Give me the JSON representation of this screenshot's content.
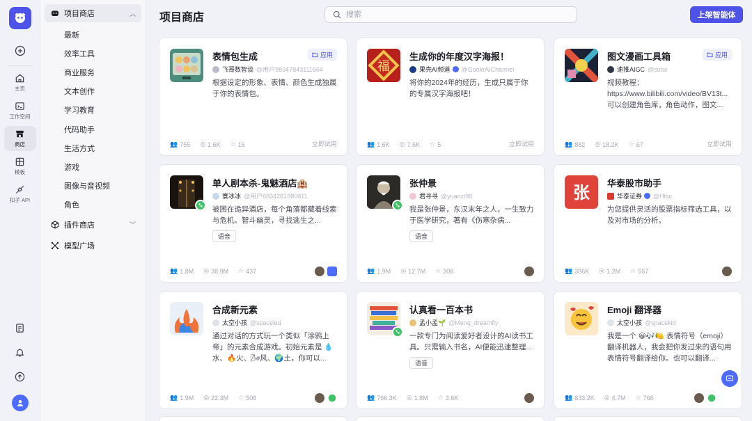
{
  "rail": {
    "items": [
      {
        "label": "主页",
        "icon": "home-icon"
      },
      {
        "label": "工作空间",
        "icon": "workspace-icon"
      },
      {
        "label": "商店",
        "icon": "store-icon"
      },
      {
        "label": "模板",
        "icon": "template-icon"
      },
      {
        "label": "扣子 API",
        "icon": "api-icon"
      }
    ]
  },
  "sidebar": {
    "store_group": "项目商店",
    "categories": [
      "最新",
      "效率工具",
      "商业服务",
      "文本创作",
      "学习教育",
      "代码助手",
      "生活方式",
      "游戏",
      "图像与音视频",
      "角色"
    ],
    "plugin_group": "插件商店",
    "model_group": "模型广场"
  },
  "header": {
    "title": "项目商店",
    "search_placeholder": "搜索",
    "publish_button": "上架智能体"
  },
  "labels": {
    "app_tag": "应用",
    "try_now": "立即试用"
  },
  "cards": [
    {
      "title": "表情包生成",
      "author": "飞哥数智谈",
      "handle": "@用户98347843111664",
      "desc": "根据设定的形象、表情、颜色生成独属于你的表情包。",
      "users": "755",
      "chats": "1.6K",
      "stars": "16",
      "tag": "应用"
    },
    {
      "title": "生成你的年度汉字海报！",
      "author": "果壳AI频道",
      "handle": "@GuokrAIChannel",
      "desc": "将你的2024年的经历，生成只属于你的专属汉字海报吧！",
      "users": "1.6K",
      "chats": "7.6K",
      "stars": "5"
    },
    {
      "title": "图文漫画工具箱",
      "author": "速推AIGC",
      "handle": "@sutui",
      "desc": "视频教程：https://www.bilibili.com/video/BV13t... 可以创建角色库，角色动作，图文...",
      "users": "882",
      "chats": "18.2K",
      "stars": "67",
      "tag": "应用"
    },
    {
      "title": "单人剧本杀-鬼魅酒店🏨",
      "author": "寰冰冰",
      "handle": "@用户6834281880811",
      "desc": "被困在诡异酒店，每个角落都藏着线索与危机。智斗幽灵，寻找逃生之...",
      "chip": "语音",
      "users": "1.8M",
      "chats": "38.9M",
      "stars": "437"
    },
    {
      "title": "张仲景",
      "author": "君寻寻",
      "handle": "@yuanzi98",
      "desc": "我是张仲景，东汉末年之人，一生致力于医学研究，著有《伤寒杂病...",
      "chip": "语音",
      "users": "1.9M",
      "chats": "12.7M",
      "stars": "308"
    },
    {
      "title": "华泰股市助手",
      "author": "华泰证券",
      "handle": "@Htsc",
      "desc": "为您提供灵活的股票指标筛选工具，以及对市场的分析。",
      "users": "386K",
      "chats": "1.2M",
      "stars": "557"
    },
    {
      "title": "合成新元素",
      "author": "太空小孩",
      "handle": "@spacekid",
      "desc": "通过对话的方式玩一个类似「涂鸦上帝」的元素合成游戏。初始元素是 💧水、🔥火、🌬风、🌍土，你可以...",
      "users": "1.9M",
      "chats": "22.3M",
      "stars": "508"
    },
    {
      "title": "认真看一百本书",
      "author": "孟小孟🌱",
      "handle": "@Meng_dreamfly",
      "desc": "一款专门为阅读爱好者设计的AI读书工具。只需输入书名，AI便能迅速整理...",
      "chip": "语音",
      "users": "766.3K",
      "chats": "1.8M",
      "stars": "3.6K"
    },
    {
      "title": "Emoji 翻译器",
      "author": "太空小孩",
      "handle": "@spacekid",
      "desc": "我是一个 😀🎶🍋 表情符号（emoji）翻译机器人，我会把你发过来的语句用表情符号翻译给你。也可以翻译...",
      "users": "833.2K",
      "chats": "4.7M",
      "stars": "766"
    }
  ],
  "colors": {
    "accent": "#4d53e8",
    "call_badge": "#3fc167"
  }
}
